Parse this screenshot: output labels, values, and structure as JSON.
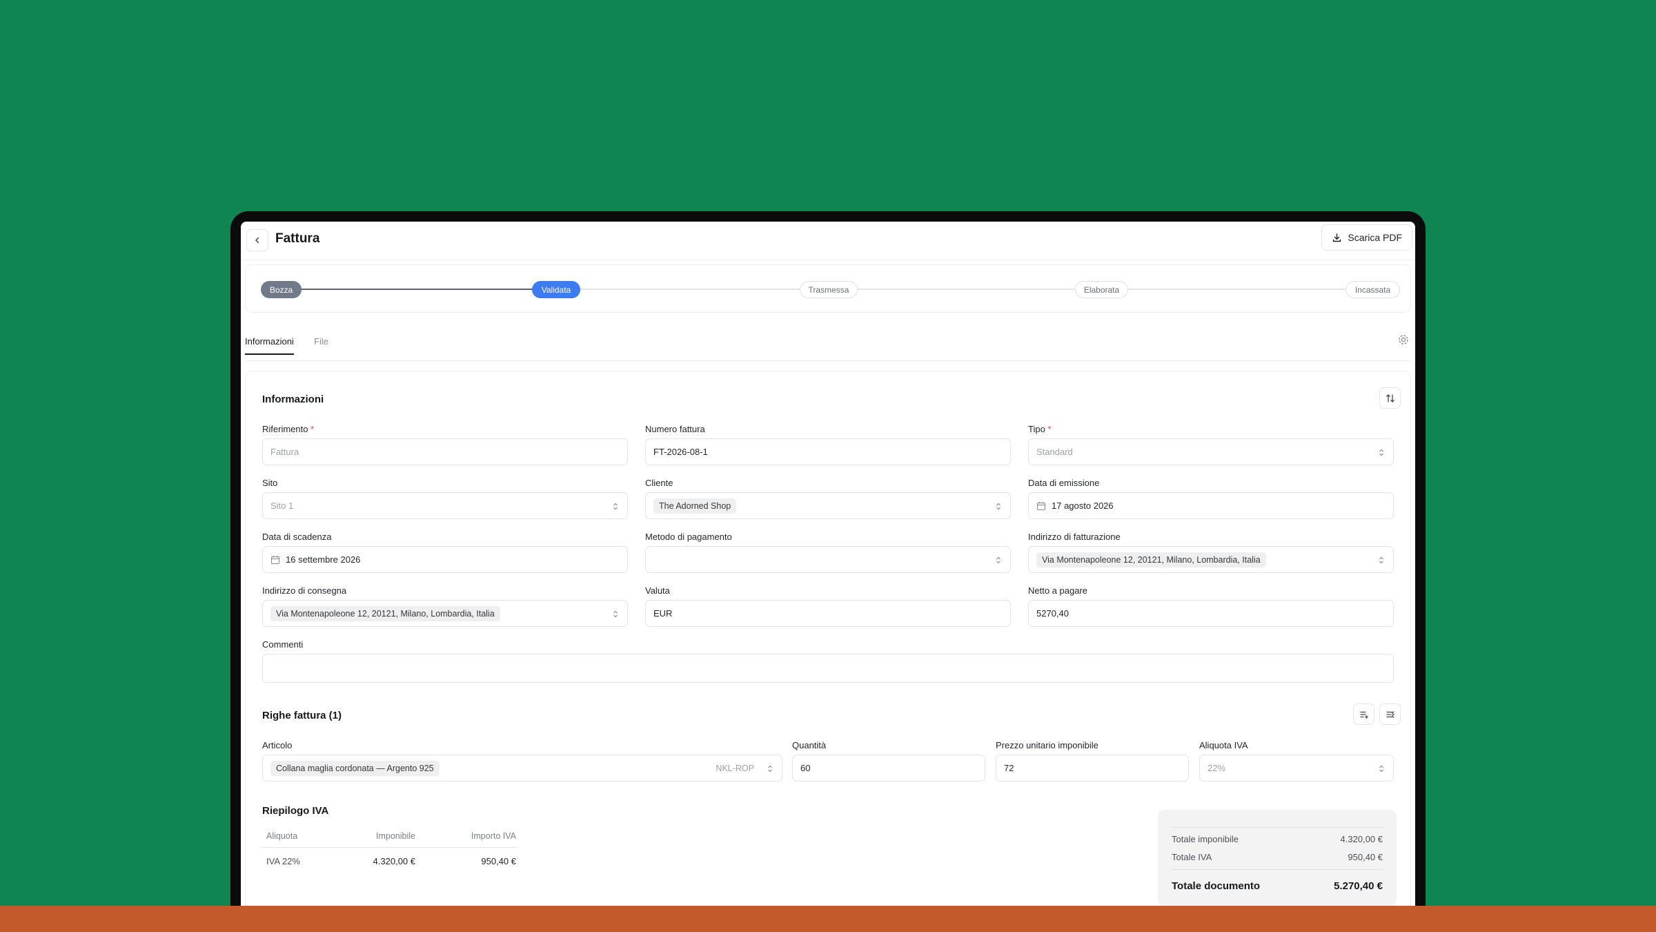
{
  "header": {
    "title": "Fattura",
    "pdf_label": "Scarica PDF"
  },
  "stepper": {
    "steps": [
      "Bozza",
      "Validata",
      "Trasmessa",
      "Elaborata",
      "Incassata"
    ],
    "current": "Validata"
  },
  "tabs": [
    "Informazioni",
    "File"
  ],
  "info": {
    "title": "Informazioni",
    "riferimento": {
      "label": "Riferimento",
      "placeholder": "Fattura"
    },
    "numero": {
      "label": "Numero fattura",
      "value": "FT-2026-08-1"
    },
    "tipo": {
      "label": "Tipo",
      "placeholder": "Standard"
    },
    "sito": {
      "label": "Sito",
      "placeholder": "Sito 1"
    },
    "cliente": {
      "label": "Cliente",
      "value": "The Adorned Shop"
    },
    "emissione": {
      "label": "Data di emissione",
      "value": "17 agosto 2026"
    },
    "scadenza": {
      "label": "Data di scadenza",
      "value": "16 settembre 2026"
    },
    "pagamento": {
      "label": "Metodo di pagamento",
      "value": ""
    },
    "fatturazione": {
      "label": "Indirizzo di fatturazione",
      "value": "Via Montenapoleone 12, 20121, Milano, Lombardia, Italia"
    },
    "consegna": {
      "label": "Indirizzo di consegna",
      "value": "Via Montenapoleone 12, 20121, Milano, Lombardia, Italia"
    },
    "valuta": {
      "label": "Valuta",
      "value": "EUR"
    },
    "netto": {
      "label": "Netto a pagare",
      "value": "5270,40"
    },
    "commenti": {
      "label": "Commenti",
      "value": ""
    }
  },
  "righe": {
    "title": "Righe fattura (1)",
    "articolo": {
      "label": "Articolo",
      "value": "Collana maglia cordonata — Argento 925",
      "sku": "NKL-ROP"
    },
    "quantita": {
      "label": "Quantità",
      "value": "60"
    },
    "prezzo": {
      "label": "Prezzo unitario imponibile",
      "value": "72"
    },
    "aliquota": {
      "label": "Aliquota IVA",
      "placeholder": "22%"
    }
  },
  "riepilogo": {
    "title": "Riepilogo IVA",
    "headers": [
      "Aliquota",
      "Imponibile",
      "Importo IVA"
    ],
    "rows": [
      {
        "aliquota": "IVA 22%",
        "imponibile": "4.320,00 €",
        "importo": "950,40 €"
      }
    ]
  },
  "totali": {
    "imponibile_label": "Totale imponibile",
    "imponibile": "4.320,00 €",
    "iva_label": "Totale IVA",
    "iva": "950,40 €",
    "documento_label": "Totale documento",
    "documento": "5.270,40 €"
  },
  "colors": {
    "background": "#0f8651",
    "footer_bar": "#c45a2c",
    "accent": "#3d7bf2",
    "required": "#e5484d"
  }
}
